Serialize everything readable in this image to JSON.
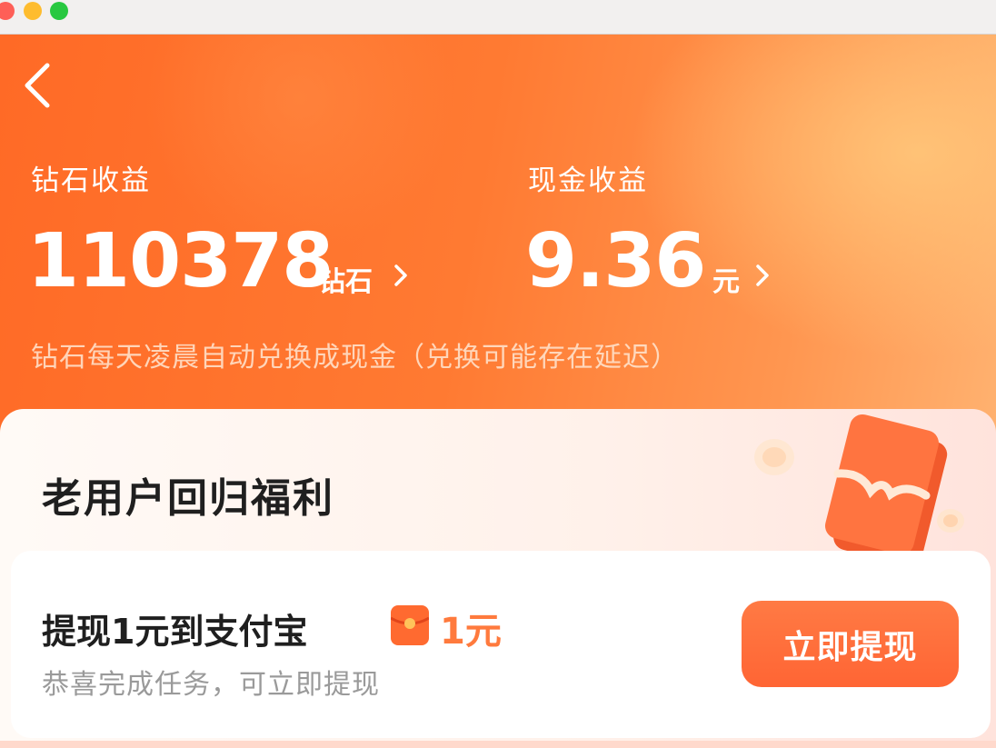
{
  "window": {
    "controls": [
      "close",
      "minimize",
      "zoom"
    ]
  },
  "header": {
    "back_icon": "chevron-left-icon",
    "diamond": {
      "label": "钻石收益",
      "value": "110378",
      "unit": "钻石"
    },
    "cash": {
      "label": "现金收益",
      "value": "9.36",
      "unit": "元"
    },
    "note": "钻石每天凌晨自动兑换成现金（兑换可能存在延迟）"
  },
  "panel": {
    "title": "老用户回归福利",
    "task": {
      "title": "提现1元到支付宝",
      "reward_icon": "red-envelope-icon",
      "reward": "1元",
      "subtitle": "恭喜完成任务，可立即提现",
      "button": "立即提现"
    }
  },
  "colors": {
    "accent": "#ff6a26",
    "button": "#ff6b38",
    "reward": "#ff7a3d"
  }
}
